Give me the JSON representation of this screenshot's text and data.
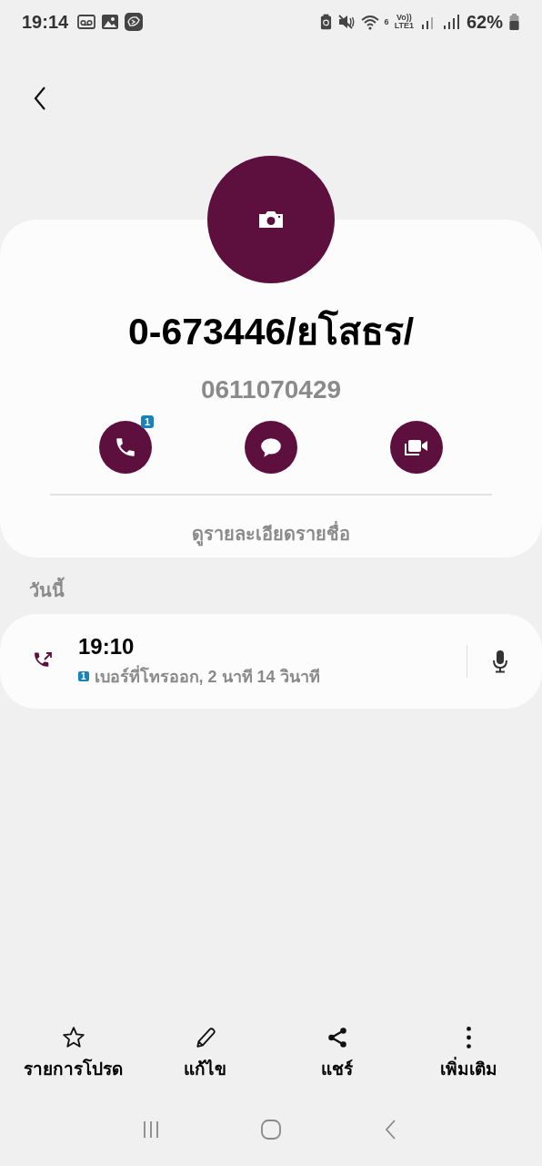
{
  "status_bar": {
    "time": "19:14",
    "wifi_band": "6",
    "volte_top": "Vo))",
    "volte_bottom": "LTE1",
    "battery": "62%"
  },
  "contact": {
    "name": "0-673446/ยโสธร/",
    "number": "0611070429"
  },
  "actions": [
    {
      "kind": "call",
      "badge": "1"
    },
    {
      "kind": "message"
    },
    {
      "kind": "video"
    }
  ],
  "details_link": "ดูรายละเอียดรายชื่อ",
  "history": {
    "heading": "วันนี้",
    "calls": [
      {
        "kind": "outgoing",
        "time": "19:10",
        "sim": "1",
        "description": "เบอร์ที่โทรออก, 2 นาที 14 วินาที"
      }
    ]
  },
  "bottom_actions": [
    {
      "kind": "favorite",
      "label": "รายการโปรด"
    },
    {
      "kind": "edit",
      "label": "แก้ไข"
    },
    {
      "kind": "share",
      "label": "แชร์"
    },
    {
      "kind": "more",
      "label": "เพิ่มเติม"
    }
  ]
}
